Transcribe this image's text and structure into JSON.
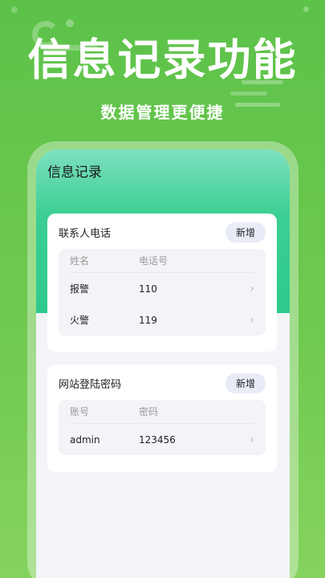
{
  "banner": {
    "headline": "信息记录功能",
    "subline": "数据管理更便捷"
  },
  "screen": {
    "title": "信息记录"
  },
  "contacts": {
    "title": "联系人电话",
    "add_label": "新增",
    "columns": [
      "姓名",
      "电话号"
    ],
    "rows": [
      {
        "name": "报警",
        "phone": "110"
      },
      {
        "name": "火警",
        "phone": "119"
      }
    ]
  },
  "logins": {
    "title": "网站登陆密码",
    "add_label": "新增",
    "columns": [
      "账号",
      "密码"
    ],
    "rows": [
      {
        "account": "admin",
        "password": "123456"
      }
    ]
  },
  "icons": {
    "row_chevron": "chevron-right-icon"
  },
  "colors": {
    "background": "#5cc24a",
    "accent_gradient": "#2fc98c",
    "button_bg": "#e9ecf7"
  }
}
